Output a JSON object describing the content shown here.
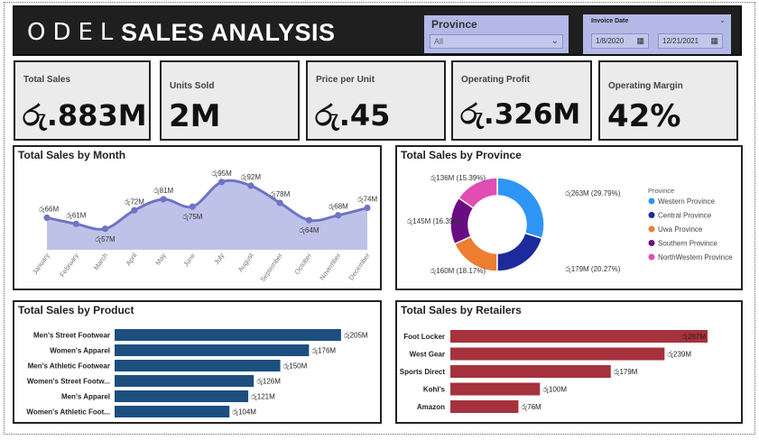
{
  "header": {
    "logo": "ODEL",
    "title": "SALES ANALYSIS",
    "province_slicer": {
      "label": "Province",
      "value": "All"
    },
    "date_slicer": {
      "label": "Invoice Date",
      "start": "1/8/2020",
      "end": "12/21/2021"
    }
  },
  "kpis": [
    {
      "label": "Total Sales",
      "value": "රු.883M"
    },
    {
      "label": "Units Sold",
      "value": "2M"
    },
    {
      "label": "Price per Unit",
      "value": "රු.45"
    },
    {
      "label": "Operating Profit",
      "value": "රු.326M"
    },
    {
      "label": "Operating Margin",
      "value": "42%"
    }
  ],
  "colors": {
    "area_fill": "#bfc2e8",
    "line": "#6f74c4",
    "product_bar": "#1c4e80",
    "retailer_bar": "#a5323c",
    "provinces": [
      "#2f95f5",
      "#1d2a9b",
      "#ed7d31",
      "#6a0d83",
      "#e14db4"
    ]
  },
  "charts": {
    "month": {
      "title": "Total Sales by Month",
      "chart_data": {
        "type": "area",
        "categories": [
          "January",
          "February",
          "March",
          "April",
          "May",
          "June",
          "July",
          "August",
          "September",
          "October",
          "November",
          "December"
        ],
        "values": [
          66,
          61,
          57,
          72,
          81,
          75,
          95,
          92,
          78,
          64,
          68,
          74
        ],
        "labels": [
          "රු66M",
          "රු61M",
          "රු57M",
          "රු72M",
          "රු81M",
          "රු75M",
          "රු95M",
          "රු92M",
          "රු78M",
          "රු64M",
          "රු68M",
          "රු74M"
        ],
        "ylim": [
          40,
          100
        ]
      }
    },
    "province": {
      "title": "Total Sales by Province",
      "legend_title": "Province",
      "chart_data": {
        "type": "pie",
        "categories": [
          "Western Province",
          "Central Province",
          "Uwa Province",
          "Southern Province",
          "NorthWestern Province"
        ],
        "values": [
          263,
          179,
          160,
          145,
          136
        ],
        "percents": [
          29.79,
          20.27,
          18.17,
          16.39,
          15.39
        ],
        "labels": [
          "රු263M (29.79%)",
          "රු179M (20.27%)",
          "රු160M (18.17%)",
          "රු145M (16.39%)",
          "රු136M (15.39%)"
        ]
      }
    },
    "product": {
      "title": "Total Sales by Product",
      "chart_data": {
        "type": "bar",
        "categories": [
          "Men's Street Footwear",
          "Women's Apparel",
          "Men's Athletic Footwear",
          "Women's Street Footw...",
          "Men's Apparel",
          "Women's Athletic Foot..."
        ],
        "values": [
          205,
          176,
          150,
          126,
          121,
          104
        ],
        "labels": [
          "රු205M",
          "රු176M",
          "රු150M",
          "රු126M",
          "රු121M",
          "රු104M"
        ],
        "xlim": [
          0,
          210
        ]
      }
    },
    "retailer": {
      "title": "Total Sales by Retailers",
      "chart_data": {
        "type": "bar",
        "categories": [
          "Foot Locker",
          "West Gear",
          "Sports Direct",
          "Kohl's",
          "Amazon"
        ],
        "values": [
          287,
          239,
          179,
          100,
          76
        ],
        "labels": [
          "රු287M",
          "රු239M",
          "රු179M",
          "රු100M",
          "රු76M"
        ],
        "xlim": [
          0,
          287
        ]
      }
    }
  }
}
